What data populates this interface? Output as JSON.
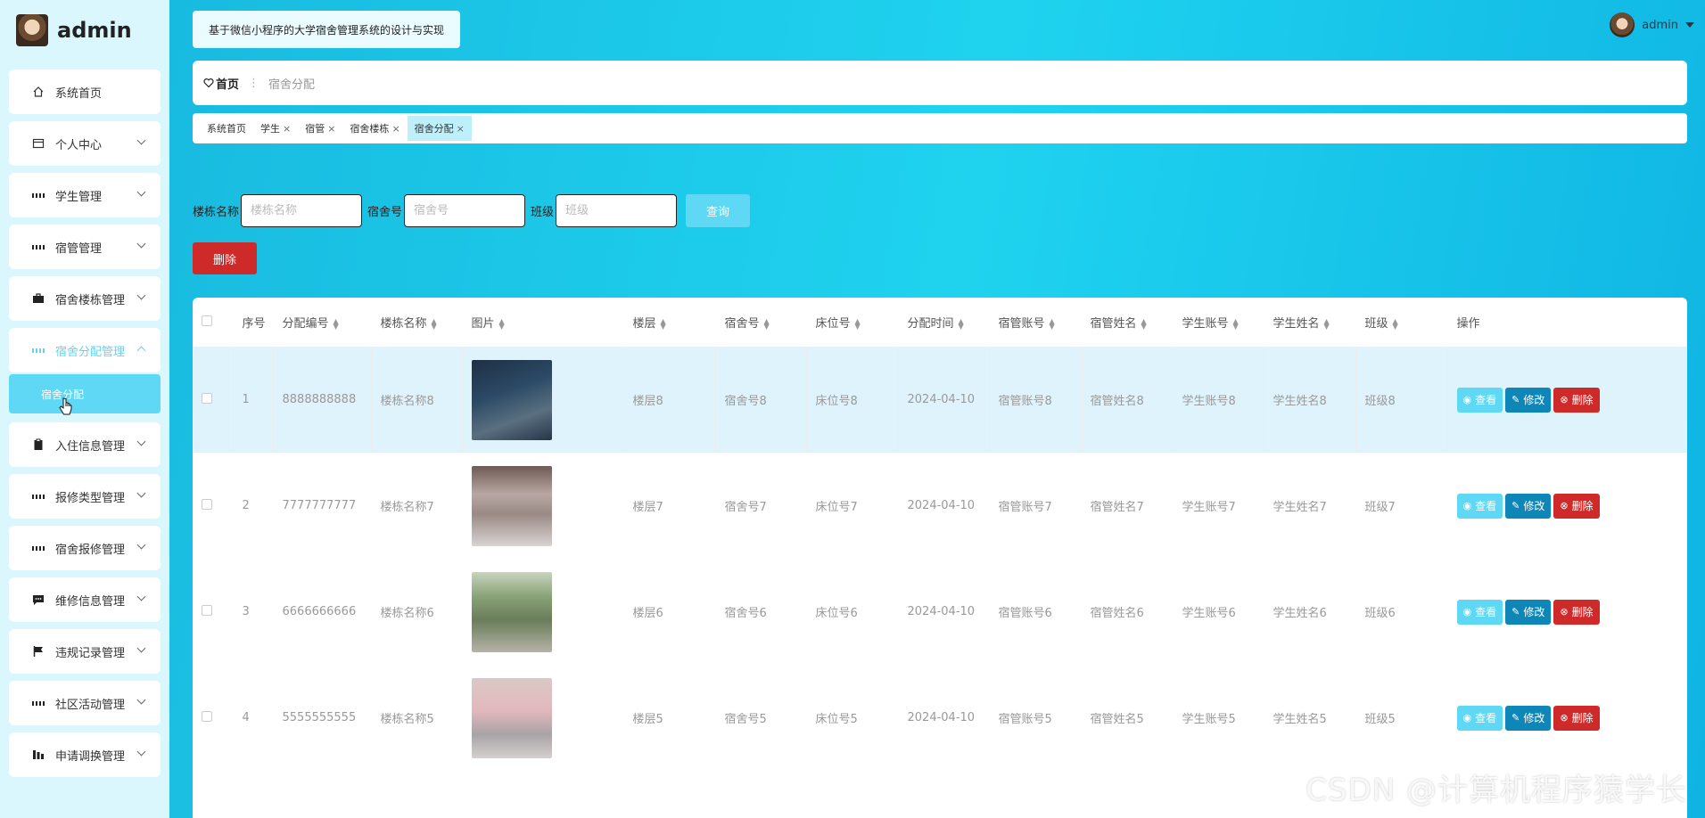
{
  "sidebar": {
    "brand": "admin",
    "items": [
      {
        "label": "系统首页",
        "icon": "home-icon"
      },
      {
        "label": "个人中心",
        "icon": "card-icon"
      },
      {
        "label": "学生管理",
        "icon": "grid-icon"
      },
      {
        "label": "宿管管理",
        "icon": "grid-icon"
      },
      {
        "label": "宿舍楼栋管理",
        "icon": "briefcase-icon"
      },
      {
        "label": "宿舍分配管理",
        "icon": "grid-icon"
      },
      {
        "label": "入住信息管理",
        "icon": "clipboard-icon"
      },
      {
        "label": "报修类型管理",
        "icon": "grid-icon"
      },
      {
        "label": "宿舍报修管理",
        "icon": "grid-icon"
      },
      {
        "label": "维修信息管理",
        "icon": "message-icon"
      },
      {
        "label": "违规记录管理",
        "icon": "flag-icon"
      },
      {
        "label": "社区活动管理",
        "icon": "grid-icon"
      },
      {
        "label": "申请调换管理",
        "icon": "chart-icon"
      }
    ],
    "sub_item": "宿舍分配"
  },
  "header": {
    "system_title": "基于微信小程序的大学宿舍管理系统的设计与实现",
    "user": "admin"
  },
  "breadcrumb": {
    "home": "首页",
    "current": "宿舍分配"
  },
  "tabs": [
    {
      "label": "系统首页",
      "closable": false
    },
    {
      "label": "学生",
      "closable": true
    },
    {
      "label": "宿管",
      "closable": true
    },
    {
      "label": "宿舍楼栋",
      "closable": true
    },
    {
      "label": "宿舍分配",
      "closable": true,
      "active": true
    }
  ],
  "search": {
    "building_label": "楼栋名称",
    "building_placeholder": "楼栋名称",
    "room_label": "宿舍号",
    "room_placeholder": "宿舍号",
    "class_label": "班级",
    "class_placeholder": "班级",
    "query_button": "查询",
    "delete_button": "删除"
  },
  "table": {
    "columns": [
      "序号",
      "分配编号",
      "楼栋名称",
      "图片",
      "楼层",
      "宿舍号",
      "床位号",
      "分配时间",
      "宿管账号",
      "宿管姓名",
      "学生账号",
      "学生姓名",
      "班级",
      "操作"
    ],
    "rows": [
      {
        "no": "1",
        "code": "8888888888",
        "building": "楼栋名称8",
        "floor": "楼层8",
        "room": "宿舍号8",
        "bed": "床位号8",
        "time": "2024-04-10",
        "mgr_acct": "宿管账号8",
        "mgr_name": "宿管姓名8",
        "stu_acct": "学生账号8",
        "stu_name": "学生姓名8",
        "class": "班级8"
      },
      {
        "no": "2",
        "code": "7777777777",
        "building": "楼栋名称7",
        "floor": "楼层7",
        "room": "宿舍号7",
        "bed": "床位号7",
        "time": "2024-04-10",
        "mgr_acct": "宿管账号7",
        "mgr_name": "宿管姓名7",
        "stu_acct": "学生账号7",
        "stu_name": "学生姓名7",
        "class": "班级7"
      },
      {
        "no": "3",
        "code": "6666666666",
        "building": "楼栋名称6",
        "floor": "楼层6",
        "room": "宿舍号6",
        "bed": "床位号6",
        "time": "2024-04-10",
        "mgr_acct": "宿管账号6",
        "mgr_name": "宿管姓名6",
        "stu_acct": "学生账号6",
        "stu_name": "学生姓名6",
        "class": "班级6"
      },
      {
        "no": "4",
        "code": "5555555555",
        "building": "楼栋名称5",
        "floor": "楼层5",
        "room": "宿舍号5",
        "bed": "床位号5",
        "time": "2024-04-10",
        "mgr_acct": "宿管账号5",
        "mgr_name": "宿管姓名5",
        "stu_acct": "学生账号5",
        "stu_name": "学生姓名5",
        "class": "班级5"
      }
    ],
    "ops": {
      "view": "查看",
      "edit": "修改",
      "delete": "删除"
    }
  },
  "watermark": "CSDN @计算机程序猿学长",
  "colors": {
    "accent": "#5ed8f5",
    "danger": "#cf2a2a",
    "edit": "#0f86b8"
  }
}
